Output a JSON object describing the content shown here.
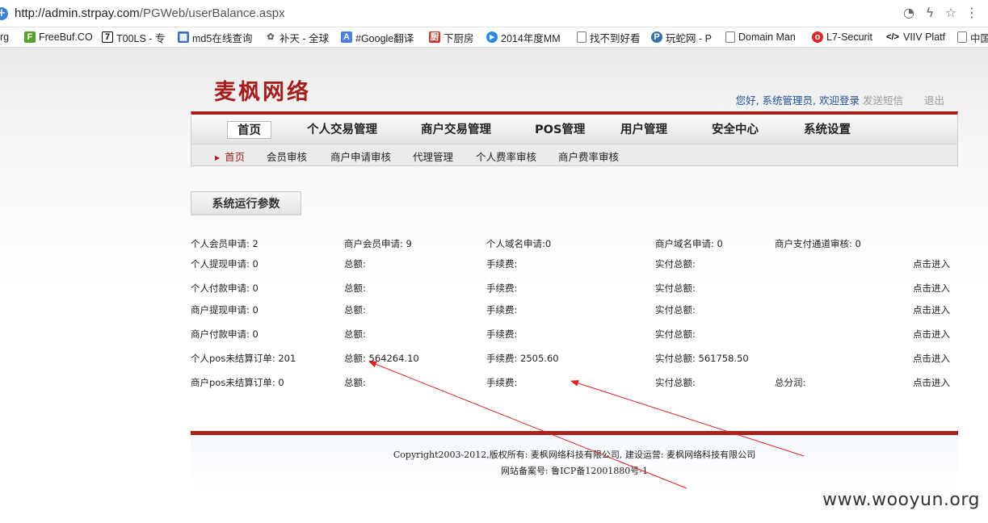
{
  "browser": {
    "url_host": "http://admin.strpay.com",
    "url_path": "/PGWeb/userBalance.aspx",
    "bookmarks": [
      {
        "label": "rg",
        "icon": "none"
      },
      {
        "label": "FreeBuf.CO",
        "icon": "freebuf-icon"
      },
      {
        "label": "T00LS - 专",
        "icon": "tools-icon"
      },
      {
        "label": "md5在线查询",
        "icon": "md5-icon"
      },
      {
        "label": "补天 - 全球",
        "icon": "butian-icon"
      },
      {
        "label": "#Google翻译",
        "icon": "translate-icon"
      },
      {
        "label": "下厨房",
        "icon": "xiachufang-icon"
      },
      {
        "label": "2014年度MM",
        "icon": "video-icon"
      },
      {
        "label": "找不到好看",
        "icon": "page-icon"
      },
      {
        "label": "玩蛇网 - P",
        "icon": "python-icon"
      },
      {
        "label": "Domain Man",
        "icon": "page-icon"
      },
      {
        "label": "L7-Securit",
        "icon": "l7-icon"
      },
      {
        "label": "VIIV Platf",
        "icon": "code-icon"
      },
      {
        "label": "中国",
        "icon": "page-icon"
      }
    ]
  },
  "header": {
    "logo": "麦枫网络",
    "greeting": "您好, 系统管理员, 欢迎登录",
    "sms_label": "发送短信",
    "logout_label": "退出"
  },
  "nav": {
    "main": [
      "首页",
      "个人交易管理",
      "商户交易管理",
      "POS管理",
      "用户管理",
      "安全中心",
      "系统设置"
    ],
    "sub": [
      "首页",
      "会员审核",
      "商户申请审核",
      "代理管理",
      "个人费率审核",
      "商户费率审核"
    ]
  },
  "section": {
    "title": "系统运行参数"
  },
  "stats": {
    "row0": {
      "c1": "个人会员申请: 2",
      "c2": "商户会员申请: 9",
      "c3": "个人域名申请:0",
      "c4": "商户域名申请: 0",
      "c5": "商户支付通道审核: 0"
    },
    "rows": [
      {
        "label": "个人提现申请: 0",
        "total": "总额:",
        "fee": "手续费:",
        "actual": "实付总额:",
        "extra": "",
        "link": "点击进入"
      },
      {
        "label": "个人付款申请: 0",
        "total": "总额:",
        "fee": "手续费:",
        "actual": "实付总额:",
        "extra": "",
        "link": "点击进入"
      },
      {
        "label": "商户提现申请: 0",
        "total": "总额:",
        "fee": "手续费:",
        "actual": "实付总额:",
        "extra": "",
        "link": "点击进入"
      },
      {
        "label": "商户付款申请: 0",
        "total": "总额:",
        "fee": "手续费:",
        "actual": "实付总额:",
        "extra": "",
        "link": "点击进入"
      },
      {
        "label": "个人pos未结算订单: 201",
        "total": "总额: 564264.10",
        "fee": "手续费: 2505.60",
        "actual": "实付总额: 561758.50",
        "extra": "",
        "link": "点击进入"
      },
      {
        "label": "商户pos未结算订单: 0",
        "total": "总额:",
        "fee": "手续费:",
        "actual": "实付总额:",
        "extra": "总分润:",
        "link": "点击进入"
      }
    ]
  },
  "footer": {
    "copyright": "Copyright2003-2012,版权所有: 麦枫网络科技有限公司, 建设运营: 麦枫网络科技有限公司",
    "icp": "网站备案号: 鲁ICP备12001880号-1"
  },
  "watermark": "www.wooyun.org",
  "colors": {
    "brand_red": "#a51e1e",
    "link_blue": "#1f4f9a",
    "annotation_red": "#e02020"
  }
}
